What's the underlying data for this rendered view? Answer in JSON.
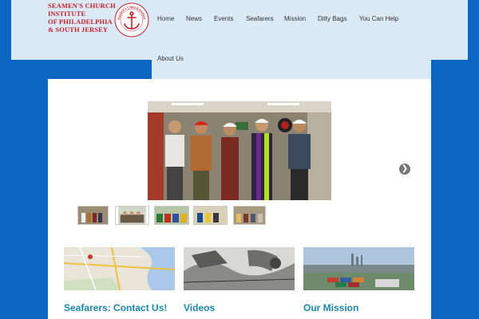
{
  "logo": {
    "lines": [
      "Seamen's Church",
      "Institute",
      "of Philadelphia",
      "& South Jersey"
    ],
    "seal_text": "Seamen's Church Institute"
  },
  "nav": {
    "items": [
      "Home",
      "News",
      "Events",
      "Seafarers",
      "Mission",
      "Ditty Bags",
      "You Can Help",
      "About Us"
    ]
  },
  "slider": {
    "next_icon": "chevron-right-icon"
  },
  "cards": [
    {
      "title": "Seafarers: Contact Us!",
      "image": "map-image"
    },
    {
      "title": "Videos",
      "image": "sketch-image"
    },
    {
      "title": "Our Mission",
      "image": "port-image"
    }
  ],
  "colors": {
    "background": "#0a66c2",
    "header": "#dbe9f7",
    "brand_red": "#c0202a",
    "link_teal": "#1a86a8"
  }
}
